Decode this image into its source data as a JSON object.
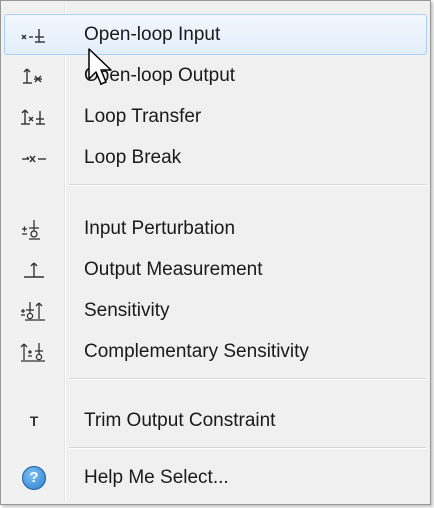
{
  "menu": {
    "items": [
      {
        "label": "Open-loop Input",
        "icon": "open-loop-input-icon"
      },
      {
        "label": "Open-loop Output",
        "icon": "open-loop-output-icon"
      },
      {
        "label": "Loop Transfer",
        "icon": "loop-transfer-icon"
      },
      {
        "label": "Loop Break",
        "icon": "loop-break-icon"
      },
      {
        "label": "Input Perturbation",
        "icon": "input-perturbation-icon"
      },
      {
        "label": "Output Measurement",
        "icon": "output-measurement-icon"
      },
      {
        "label": "Sensitivity",
        "icon": "sensitivity-icon"
      },
      {
        "label": "Complementary Sensitivity",
        "icon": "complementary-sensitivity-icon"
      },
      {
        "label": "Trim Output Constraint",
        "icon": "trim-output-constraint-icon"
      },
      {
        "label": "Help Me Select...",
        "icon": "help-icon"
      }
    ],
    "trim_icon_glyph": "T",
    "help_icon_glyph": "?",
    "hovered_item": "Open-loop Input"
  },
  "colors": {
    "hover_border": "#aecff7",
    "help_icon_fill": "#3a8fd8"
  }
}
